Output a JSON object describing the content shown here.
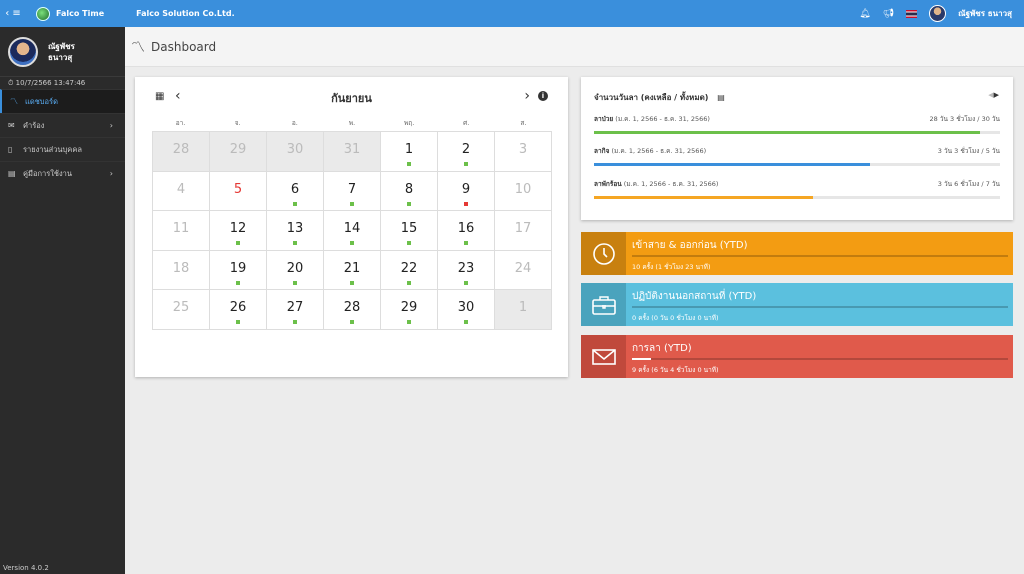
{
  "topbar": {
    "menu_icon": "‹ ≡",
    "brand": "Falco Time",
    "company": "Falco Solution Co.Ltd.",
    "user": "ณัฐพัชร ธนาวสุ",
    "icons": [
      "bell-icon",
      "megaphone-icon",
      "thai-flag-icon"
    ]
  },
  "sidebar": {
    "profile_name_line1": "ณัฐพัชร",
    "profile_name_line2": "ธนาวสุ",
    "login_time": "⏱ 10/7/2566 13:47:46",
    "items": [
      {
        "label": "แดชบอร์ด",
        "icon": "chart-line-icon",
        "active": true
      },
      {
        "label": "คำร้อง",
        "icon": "envelope-icon",
        "chevron": true
      },
      {
        "label": "รายงานส่วนบุคคล",
        "icon": "file-icon"
      },
      {
        "label": "คู่มือการใช้งาน",
        "icon": "book-icon",
        "chevron": true
      }
    ],
    "version": "Version 4.0.2"
  },
  "page": {
    "title": "Dashboard"
  },
  "calendar": {
    "month": "กันยายน",
    "weekdays": [
      "อา.",
      "จ.",
      "อ.",
      "พ.",
      "พฤ.",
      "ศ.",
      "ส."
    ],
    "weeks": [
      [
        {
          "d": "28",
          "s": "out"
        },
        {
          "d": "29",
          "s": "out"
        },
        {
          "d": "30",
          "s": "out"
        },
        {
          "d": "31",
          "s": "out"
        },
        {
          "d": "1",
          "dot": "green"
        },
        {
          "d": "2",
          "dot": "green"
        },
        {
          "d": "3",
          "s": "weekend"
        }
      ],
      [
        {
          "d": "4",
          "s": "weekend"
        },
        {
          "d": "5",
          "s": "holiday"
        },
        {
          "d": "6",
          "dot": "green"
        },
        {
          "d": "7",
          "dot": "green"
        },
        {
          "d": "8",
          "dot": "green"
        },
        {
          "d": "9",
          "dot": "red"
        },
        {
          "d": "10",
          "s": "weekend"
        }
      ],
      [
        {
          "d": "11",
          "s": "weekend"
        },
        {
          "d": "12",
          "dot": "green"
        },
        {
          "d": "13",
          "dot": "green"
        },
        {
          "d": "14",
          "dot": "green"
        },
        {
          "d": "15",
          "dot": "green"
        },
        {
          "d": "16",
          "dot": "green"
        },
        {
          "d": "17",
          "s": "weekend"
        }
      ],
      [
        {
          "d": "18",
          "s": "weekend"
        },
        {
          "d": "19",
          "dot": "green"
        },
        {
          "d": "20",
          "dot": "green"
        },
        {
          "d": "21",
          "dot": "green"
        },
        {
          "d": "22",
          "dot": "green"
        },
        {
          "d": "23",
          "dot": "green"
        },
        {
          "d": "24",
          "s": "weekend"
        }
      ],
      [
        {
          "d": "25",
          "s": "weekend"
        },
        {
          "d": "26",
          "dot": "green"
        },
        {
          "d": "27",
          "dot": "green"
        },
        {
          "d": "28",
          "dot": "green"
        },
        {
          "d": "29",
          "dot": "green"
        },
        {
          "d": "30",
          "dot": "green"
        },
        {
          "d": "1",
          "s": "out"
        }
      ]
    ]
  },
  "leave": {
    "title": "จำนวนวันลา (คงเหลือ / ทั้งหมด)",
    "rows": [
      {
        "type": "ลาป่วย",
        "period": "(ม.ค. 1, 2566 - ธ.ค. 31, 2566)",
        "value": "28 วัน 3 ชั่วโมง / 30 วัน",
        "fraction": 0.95,
        "color": "#6cc04a"
      },
      {
        "type": "ลากิจ",
        "period": "(ม.ค. 1, 2566 - ธ.ค. 31, 2566)",
        "value": "3 วัน 3 ชั่วโมง / 5 วัน",
        "fraction": 0.68,
        "color": "#3a8fdc"
      },
      {
        "type": "ลาพักร้อน",
        "period": "(ม.ค. 1, 2566 - ธ.ค. 31, 2566)",
        "value": "3 วัน 6 ชั่วโมง / 7 วัน",
        "fraction": 0.54,
        "color": "#f5a623"
      }
    ]
  },
  "stats": [
    {
      "title": "เข้าสาย & ออกก่อน (YTD)",
      "sub": "10 ครั้ง (1 ชั่วโมง 23 นาที)",
      "icon": "clock-icon",
      "fill": 0
    },
    {
      "title": "ปฏิบัติงานนอกสถานที่ (YTD)",
      "sub": "0 ครั้ง (0 วัน 0 ชั่วโมง 0 นาที)",
      "icon": "briefcase-icon",
      "fill": 0
    },
    {
      "title": "การลา (YTD)",
      "sub": "9 ครั้ง (6 วัน 4 ชั่วโมง 0 นาที)",
      "icon": "envelope-icon",
      "fill": 0.05
    }
  ]
}
